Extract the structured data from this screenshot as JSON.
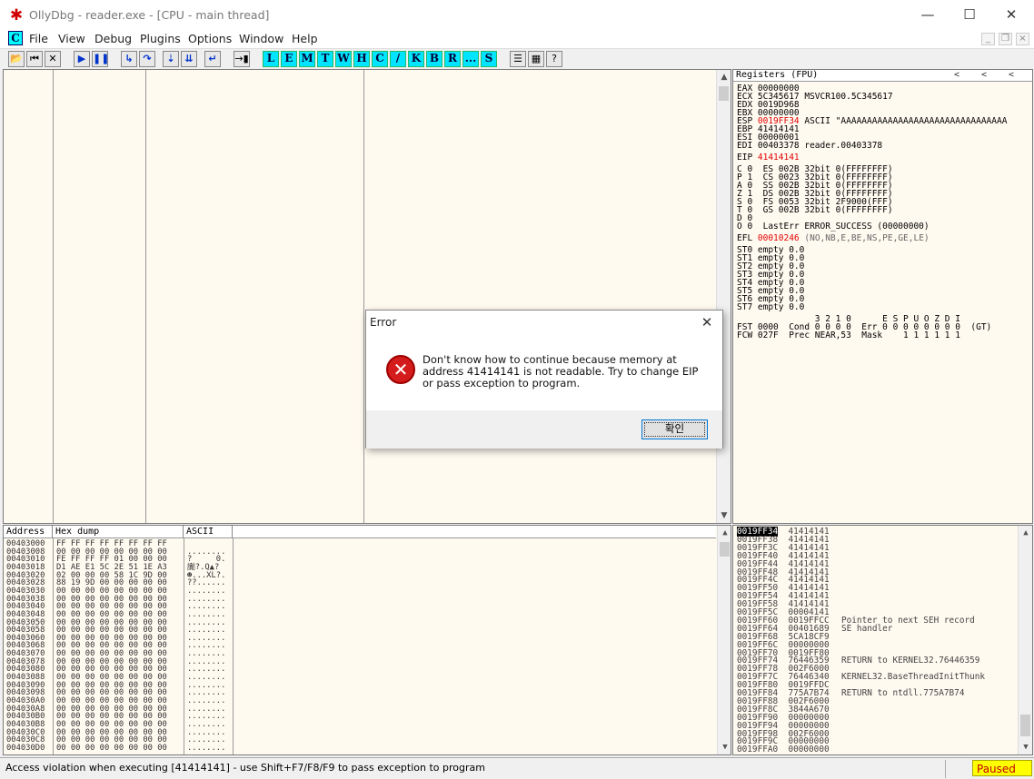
{
  "window": {
    "title": "OllyDbg - reader.exe - [CPU - main thread]",
    "minimize": "—",
    "maximize": "☐",
    "close": "✕"
  },
  "menu": {
    "icon_letter": "C",
    "items": [
      "File",
      "View",
      "Debug",
      "Plugins",
      "Options",
      "Window",
      "Help"
    ]
  },
  "toolbar": {
    "letters": [
      "L",
      "E",
      "M",
      "T",
      "W",
      "H",
      "C",
      "/",
      "K",
      "B",
      "R",
      "...",
      "S"
    ]
  },
  "registers": {
    "header": "Registers (FPU)",
    "lines": [
      {
        "text": "EAX 00000000"
      },
      {
        "text": "ECX 5C345617 MSVCR100.5C345617"
      },
      {
        "text": "EDX 0019D968"
      },
      {
        "text": "EBX 00000000"
      },
      {
        "prefix": "ESP ",
        "red": "0019FF34",
        "text": " ASCII \"AAAAAAAAAAAAAAAAAAAAAAAAAAAAAAAA"
      },
      {
        "text": "EBP 41414141"
      },
      {
        "text": "ESI 00000001"
      },
      {
        "text": "EDI 00403378 reader.00403378"
      },
      {
        "prefix": "EIP ",
        "red": "41414141",
        "text": ""
      },
      {
        "text": "C 0  ES 002B 32bit 0(FFFFFFFF)"
      },
      {
        "text": "P 1  CS 0023 32bit 0(FFFFFFFF)"
      },
      {
        "text": "A 0  SS 002B 32bit 0(FFFFFFFF)"
      },
      {
        "text": "Z 1  DS 002B 32bit 0(FFFFFFFF)"
      },
      {
        "text": "S 0  FS 0053 32bit 2F9000(FFF)"
      },
      {
        "text": "T 0  GS 002B 32bit 0(FFFFFFFF)"
      },
      {
        "text": "D 0"
      },
      {
        "text": "O 0  LastErr ERROR_SUCCESS (00000000)"
      },
      {
        "prefix": "EFL ",
        "red": "00010246",
        "grey": " (NO,NB,E,BE,NS,PE,GE,LE)",
        "text": ""
      },
      {
        "text": "ST0 empty 0.0"
      },
      {
        "text": "ST1 empty 0.0"
      },
      {
        "text": "ST2 empty 0.0"
      },
      {
        "text": "ST3 empty 0.0"
      },
      {
        "text": "ST4 empty 0.0"
      },
      {
        "text": "ST5 empty 0.0"
      },
      {
        "text": "ST6 empty 0.0"
      },
      {
        "text": "ST7 empty 0.0"
      },
      {
        "text": "               3 2 1 0      E S P U O Z D I"
      },
      {
        "text": "FST 0000  Cond 0 0 0 0  Err 0 0 0 0 0 0 0 0  (GT)"
      },
      {
        "text": "FCW 027F  Prec NEAR,53  Mask    1 1 1 1 1 1"
      }
    ]
  },
  "dump": {
    "headers": [
      "Address",
      "Hex dump",
      "ASCII"
    ],
    "rows": [
      [
        "00403000",
        "FF FF FF FF FF FF FF FF",
        "        "
      ],
      [
        "00403008",
        "00 00 00 00 00 00 00 00",
        "........"
      ],
      [
        "00403010",
        "FE FF FF FF 01 00 00 00",
        "?     0."
      ],
      [
        "00403018",
        "D1 AE E1 5C 2E 51 1E A3",
        "讟?.Q▲?"
      ],
      [
        "00403020",
        "02 00 00 00 58 1C 9D 00",
        "☻...XL?."
      ],
      [
        "00403028",
        "88 19 9D 00 00 00 00 00",
        "??......"
      ],
      [
        "00403030",
        "00 00 00 00 00 00 00 00",
        "........"
      ],
      [
        "00403038",
        "00 00 00 00 00 00 00 00",
        "........"
      ],
      [
        "00403040",
        "00 00 00 00 00 00 00 00",
        "........"
      ],
      [
        "00403048",
        "00 00 00 00 00 00 00 00",
        "........"
      ],
      [
        "00403050",
        "00 00 00 00 00 00 00 00",
        "........"
      ],
      [
        "00403058",
        "00 00 00 00 00 00 00 00",
        "........"
      ],
      [
        "00403060",
        "00 00 00 00 00 00 00 00",
        "........"
      ],
      [
        "00403068",
        "00 00 00 00 00 00 00 00",
        "........"
      ],
      [
        "00403070",
        "00 00 00 00 00 00 00 00",
        "........"
      ],
      [
        "00403078",
        "00 00 00 00 00 00 00 00",
        "........"
      ],
      [
        "00403080",
        "00 00 00 00 00 00 00 00",
        "........"
      ],
      [
        "00403088",
        "00 00 00 00 00 00 00 00",
        "........"
      ],
      [
        "00403090",
        "00 00 00 00 00 00 00 00",
        "........"
      ],
      [
        "00403098",
        "00 00 00 00 00 00 00 00",
        "........"
      ],
      [
        "004030A0",
        "00 00 00 00 00 00 00 00",
        "........"
      ],
      [
        "004030A8",
        "00 00 00 00 00 00 00 00",
        "........"
      ],
      [
        "004030B0",
        "00 00 00 00 00 00 00 00",
        "........"
      ],
      [
        "004030B8",
        "00 00 00 00 00 00 00 00",
        "........"
      ],
      [
        "004030C0",
        "00 00 00 00 00 00 00 00",
        "........"
      ],
      [
        "004030C8",
        "00 00 00 00 00 00 00 00",
        "........"
      ],
      [
        "004030D0",
        "00 00 00 00 00 00 00 00",
        "........"
      ]
    ]
  },
  "stack": {
    "rows": [
      [
        "0019FF34",
        "41414141",
        ""
      ],
      [
        "0019FF38",
        "41414141",
        ""
      ],
      [
        "0019FF3C",
        "41414141",
        ""
      ],
      [
        "0019FF40",
        "41414141",
        ""
      ],
      [
        "0019FF44",
        "41414141",
        ""
      ],
      [
        "0019FF48",
        "41414141",
        ""
      ],
      [
        "0019FF4C",
        "41414141",
        ""
      ],
      [
        "0019FF50",
        "41414141",
        ""
      ],
      [
        "0019FF54",
        "41414141",
        ""
      ],
      [
        "0019FF58",
        "41414141",
        ""
      ],
      [
        "0019FF5C",
        "00004141",
        ""
      ],
      [
        "0019FF60",
        "0019FFCC",
        "Pointer to next SEH record"
      ],
      [
        "0019FF64",
        "00401689",
        "SE handler"
      ],
      [
        "0019FF68",
        "5CA18CF9",
        ""
      ],
      [
        "0019FF6C",
        "00000000",
        ""
      ],
      [
        "0019FF70",
        "0019FF80",
        ""
      ],
      [
        "0019FF74",
        "76446359",
        "RETURN to KERNEL32.76446359"
      ],
      [
        "0019FF78",
        "002F6000",
        ""
      ],
      [
        "0019FF7C",
        "76446340",
        "KERNEL32.BaseThreadInitThunk"
      ],
      [
        "0019FF80",
        "0019FFDC",
        ""
      ],
      [
        "0019FF84",
        "775A7B74",
        "RETURN to ntdll.775A7B74"
      ],
      [
        "0019FF88",
        "002F6000",
        ""
      ],
      [
        "0019FF8C",
        "3844A670",
        ""
      ],
      [
        "0019FF90",
        "00000000",
        ""
      ],
      [
        "0019FF94",
        "00000000",
        ""
      ],
      [
        "0019FF98",
        "002F6000",
        ""
      ],
      [
        "0019FF9C",
        "00000000",
        ""
      ],
      [
        "0019FFA0",
        "00000000",
        ""
      ]
    ]
  },
  "status": {
    "message": "Access violation when executing [41414141] - use Shift+F7/F8/F9 to pass exception to program",
    "state": "Paused"
  },
  "dialog": {
    "title": "Error",
    "message": "Don't know how to continue because memory at address 41414141 is not readable. Try to change EIP or pass exception to program.",
    "ok_label": "확인"
  }
}
